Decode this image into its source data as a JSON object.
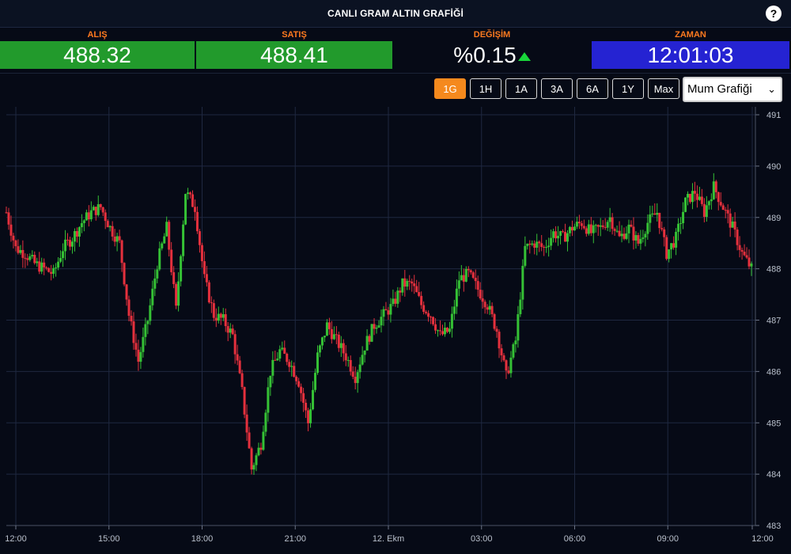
{
  "header": {
    "title": "CANLI GRAM ALTIN GRAFİĞİ",
    "help_symbol": "?"
  },
  "quotes": {
    "buy": {
      "label": "ALIŞ",
      "value": "488.32"
    },
    "sell": {
      "label": "SATIŞ",
      "value": "488.41"
    },
    "change": {
      "label": "DEĞİŞİM",
      "value": "%0.15",
      "direction": "up"
    },
    "time": {
      "label": "ZAMAN",
      "value": "12:01:03"
    }
  },
  "colors": {
    "up": "#35c135",
    "down": "#e5303d",
    "accent": "#f5891d",
    "buy_bg": "#229a2c",
    "time_bg": "#2523d2"
  },
  "toolbar": {
    "ranges": [
      "1G",
      "1H",
      "1A",
      "3A",
      "6A",
      "1Y",
      "Max"
    ],
    "active_range": "1G",
    "chart_type": "Mum Grafiği"
  },
  "chart_data": {
    "type": "candlestick",
    "title": "",
    "xlabel": "",
    "ylabel": "",
    "ylim": [
      483,
      491
    ],
    "y_ticks": [
      483,
      484,
      485,
      486,
      487,
      488,
      489,
      490,
      491
    ],
    "x_ticks": [
      "12:00",
      "15:00",
      "18:00",
      "21:00",
      "12. Ekm",
      "03:00",
      "06:00",
      "09:00",
      "12:00"
    ],
    "grid": true,
    "series": [
      {
        "values": [
          489.1,
          488.4,
          488.3,
          488.1,
          488.0,
          487.9,
          488.4,
          488.6,
          488.9,
          489.1,
          489.2,
          488.8,
          488.5,
          487.1,
          486.2,
          487.0,
          488.1,
          488.8,
          487.2,
          489.5,
          489.2,
          487.8,
          487.1,
          487.0,
          486.7,
          485.6,
          484.1,
          484.6,
          486.0,
          486.4,
          486.2,
          485.8,
          485.0,
          486.3,
          486.9,
          486.6,
          486.3,
          485.9,
          486.5,
          486.9,
          487.1,
          487.3,
          487.7,
          487.7,
          487.3,
          487.1,
          486.7,
          486.8,
          487.8,
          487.9,
          487.6,
          487.3,
          486.8,
          485.9,
          486.6,
          488.4,
          488.5,
          488.4,
          488.7,
          488.6,
          488.8,
          488.9,
          488.7,
          488.8,
          489.0,
          488.6,
          488.8,
          488.5,
          488.9,
          489.1,
          488.3,
          488.6,
          489.3,
          489.5,
          489.1,
          489.6,
          489.2,
          488.8,
          488.3,
          488.0
        ],
        "open": "first value 489.1 at 12:00",
        "last": 488.0
      }
    ]
  }
}
